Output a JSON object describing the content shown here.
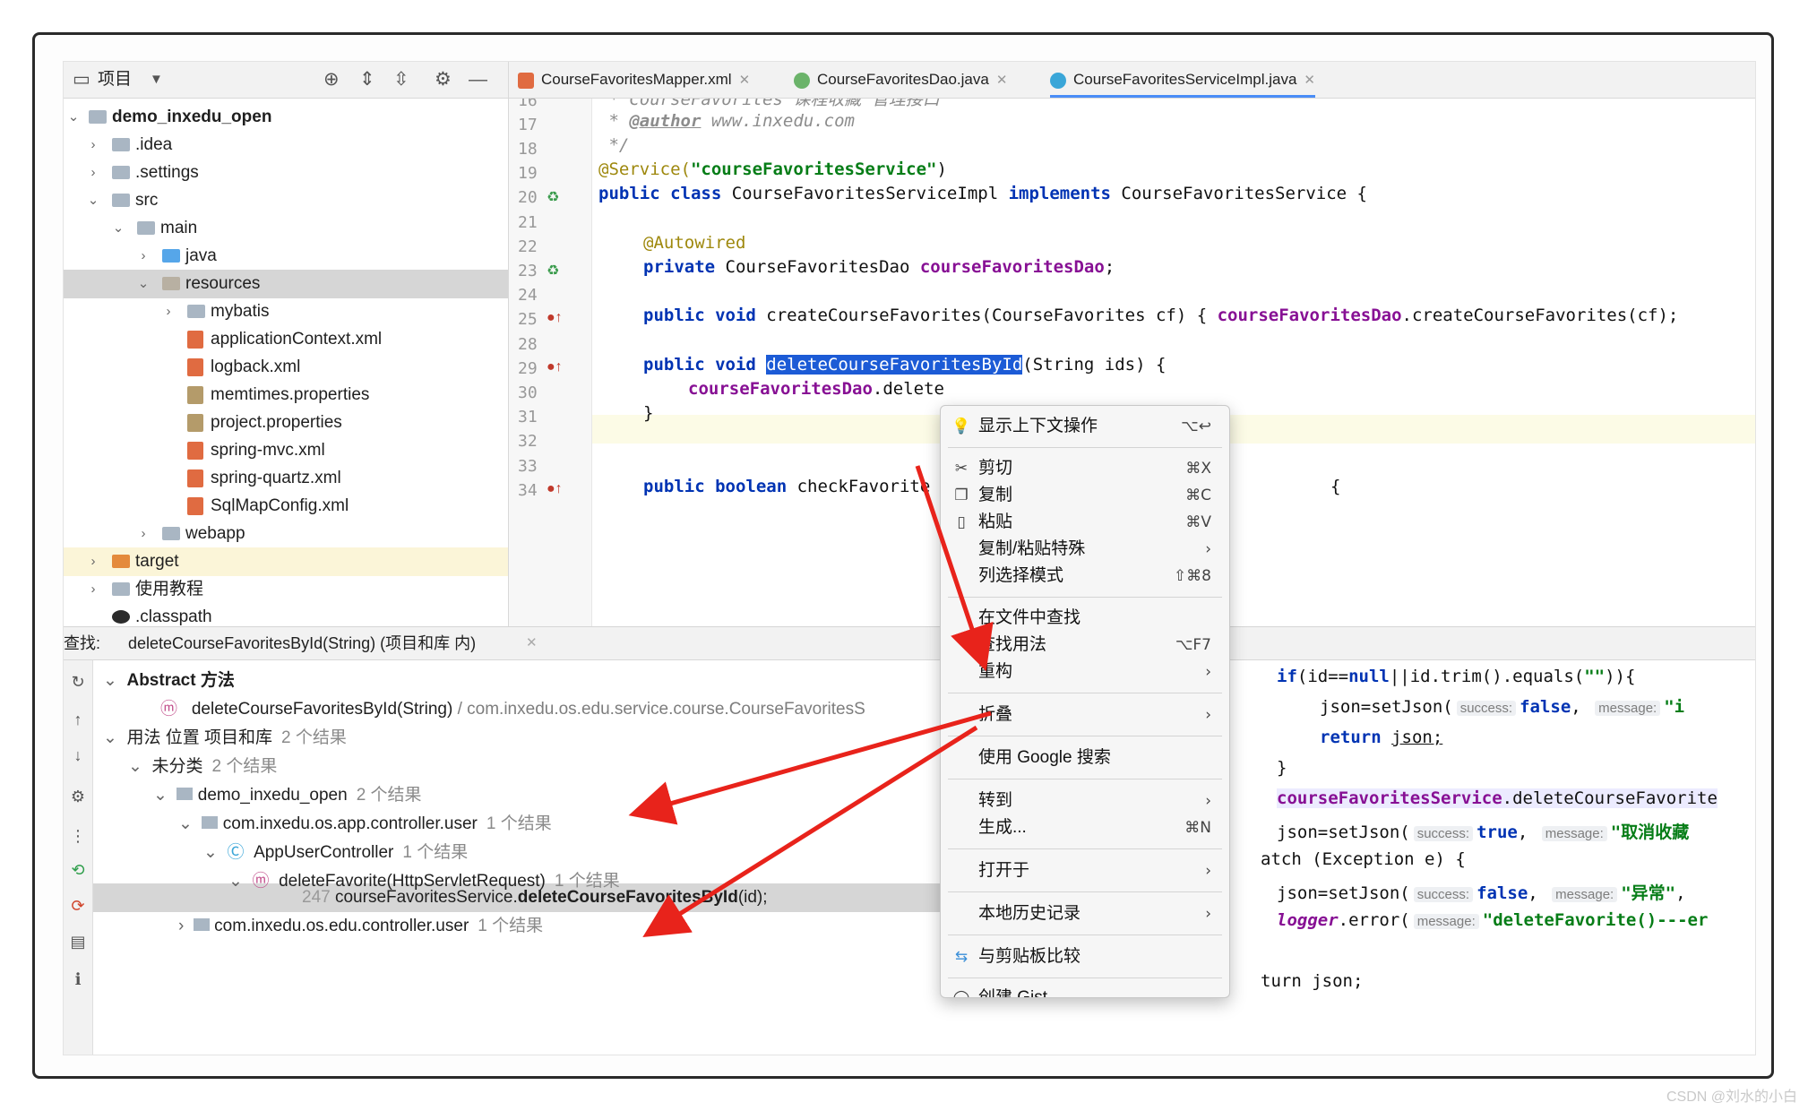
{
  "project_panel": {
    "title": "项目",
    "tree": [
      {
        "label": "demo_inxedu_open",
        "bold": true
      },
      {
        "label": ".idea"
      },
      {
        "label": ".settings"
      },
      {
        "label": "src"
      },
      {
        "label": "main"
      },
      {
        "label": "java"
      },
      {
        "label": "resources"
      },
      {
        "label": "mybatis"
      },
      {
        "label": "applicationContext.xml"
      },
      {
        "label": "logback.xml"
      },
      {
        "label": "memtimes.properties"
      },
      {
        "label": "project.properties"
      },
      {
        "label": "spring-mvc.xml"
      },
      {
        "label": "spring-quartz.xml"
      },
      {
        "label": "SqlMapConfig.xml"
      },
      {
        "label": "webapp"
      },
      {
        "label": "target"
      },
      {
        "label": "使用教程"
      },
      {
        "label": ".classpath"
      }
    ]
  },
  "tabs": [
    {
      "label": "CourseFavoritesMapper.xml",
      "icon": "xml-file-icon"
    },
    {
      "label": "CourseFavoritesDao.java",
      "icon": "interface-icon"
    },
    {
      "label": "CourseFavoritesServiceImpl.java",
      "icon": "class-icon",
      "active": true
    }
  ],
  "editor": {
    "line_numbers": [
      "16",
      "17",
      "18",
      "19",
      "20",
      "21",
      "22",
      "23",
      "24",
      "25",
      "28",
      "29",
      "30",
      "31",
      "32",
      "33",
      "34"
    ],
    "lines": {
      "l16": " * CourseFavorites 课程收藏 管理接口",
      "l17_prefix": " * ",
      "l17_tag": "@author",
      "l17_rest": " www.inxedu.com",
      "l18": " */",
      "l19_ann": "@Service(",
      "l19_str": "\"courseFavoritesService\"",
      "l19_end": ")",
      "l20_kw": "public class ",
      "l20_name": "CourseFavoritesServiceImpl ",
      "l20_kw2": "implements ",
      "l20_rest": "CourseFavoritesService {",
      "l22": "@Autowired",
      "l23_kw": "private ",
      "l23_type": "CourseFavoritesDao ",
      "l23_field": "courseFavoritesDao",
      "l23_end": ";",
      "l25_kw": "public void ",
      "l25_rest": "createCourseFavorites(CourseFavorites cf) { ",
      "l25_field": "courseFavoritesDao",
      "l25_end": ".createCourseFavorites(cf);",
      "l29_kw": "public void ",
      "l29_sel": "deleteCourseFavoritesById",
      "l29_rest": "(String ids) {",
      "l30_field": "courseFavoritesDao",
      "l30_rest": ".delete",
      "l31": "}",
      "l34_kw": "public boolean ",
      "l34_rest": "checkFavorite",
      "l34_tail": "{"
    }
  },
  "find": {
    "header_label": "查找:",
    "header_query": "deleteCourseFavoritesById(String) (项目和库 内)",
    "rows": {
      "abstract": "Abstract 方法",
      "method": "deleteCourseFavoritesById(String)",
      "method_path": "/ com.inxedu.os.edu.service.course.CourseFavoritesS",
      "usage": "用法 位置 项目和库",
      "usage_count": "2 个结果",
      "uncat": "未分类",
      "uncat_count": "2 个结果",
      "module": "demo_inxedu_open",
      "module_count": "2 个结果",
      "pkg1": "com.inxedu.os.app.controller.user",
      "pkg1_count": "1 个结果",
      "cls": "AppUserController",
      "cls_count": "1 个结果",
      "fn": "deleteFavorite(HttpServletRequest)",
      "fn_count": "1 个结果",
      "hit_line": "247",
      "hit_pre": "courseFavoritesService.",
      "hit_bold": "deleteCourseFavoritesById",
      "hit_post": "(id);",
      "pkg2": "com.inxedu.os.edu.controller.user",
      "pkg2_count": "1 个结果"
    },
    "right_code": {
      "r1_kw": "if",
      "r1_a": "(id==",
      "r1_null": "null",
      "r1_b": "||id.trim().equals(",
      "r1_str": "\"\"",
      "r1_c": ")){",
      "r2_a": "json=setJson(",
      "r2_h1": "success:",
      "r2_false": "false",
      "r2_h2": "message:",
      "r2_str": "\"i",
      "r3_kw": "return ",
      "r3_rest": "json;",
      "r4": "}",
      "r5_field": "courseFavoritesService",
      "r5_rest": ".deleteCourseFavorite",
      "r6_a": "json=setJson(",
      "r6_h1": "success:",
      "r6_true": "true",
      "r6_h2": "message:",
      "r6_str": "\"取消收藏",
      "r7": "atch (Exception e) {",
      "r8_a": "json=setJson(",
      "r8_h1": "success:",
      "r8_false": "false",
      "r8_h2": "message:",
      "r8_str": "\"异常\"",
      "r8_end": ",",
      "r9_logger": "logger",
      "r9_rest": ".error(",
      "r9_h": "message:",
      "r9_str": "\"deleteFavorite()---er",
      "r10": "turn json;"
    }
  },
  "context_menu": {
    "items": [
      {
        "label": "显示上下文操作",
        "shortcut": "⌥↩",
        "icon": "lightbulb-icon"
      },
      {
        "label": "剪切",
        "shortcut": "⌘X",
        "icon": "scissors-icon"
      },
      {
        "label": "复制",
        "shortcut": "⌘C",
        "icon": "copy-icon"
      },
      {
        "label": "粘贴",
        "shortcut": "⌘V",
        "icon": "paste-icon"
      },
      {
        "label": "复制/粘贴特殊",
        "shortcut": "›"
      },
      {
        "label": "列选择模式",
        "shortcut": "⇧⌘8"
      },
      {
        "label": "在文件中查找",
        "shortcut": ""
      },
      {
        "label": "查找用法",
        "shortcut": "⌥F7"
      },
      {
        "label": "重构",
        "shortcut": "›"
      },
      {
        "label": "折叠",
        "shortcut": "›"
      },
      {
        "label": "使用 Google 搜索",
        "shortcut": ""
      },
      {
        "label": "转到",
        "shortcut": "›"
      },
      {
        "label": "生成...",
        "shortcut": "⌘N"
      },
      {
        "label": "打开于",
        "shortcut": "›"
      },
      {
        "label": "本地历史记录",
        "shortcut": "›"
      },
      {
        "label": "与剪贴板比较",
        "shortcut": "",
        "icon": "compare-icon"
      },
      {
        "label": "创建 Gist...",
        "shortcut": "",
        "icon": "github-icon"
      }
    ]
  },
  "watermark": "CSDN @刘水的小白",
  "colors": {
    "selection": "#1c5bd6",
    "keyword": "#0033b3",
    "string": "#067d17",
    "field": "#871094",
    "arrow": "#e8231b"
  }
}
